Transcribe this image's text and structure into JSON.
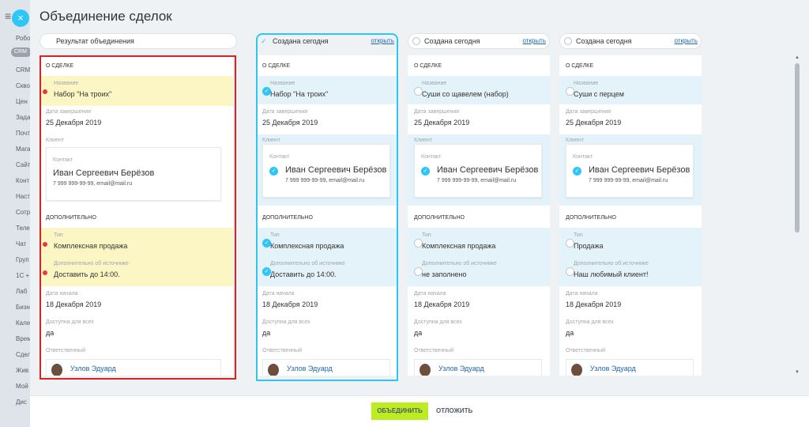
{
  "background_sidebar": {
    "menu_icon": "≡",
    "crm_badge": "CRM",
    "items": [
      "Робо",
      "CRM",
      "CRM",
      "Скво",
      "Цен",
      "Зада",
      "Почт",
      "Мага",
      "Сайт",
      "Конт",
      "Наст",
      "Сотр",
      "Теле",
      "Чат",
      "Груп",
      "1С +",
      "Лаб",
      "Бизн",
      "Кале",
      "Врем",
      "Сдел",
      "Жив",
      "Мой",
      "Дис"
    ]
  },
  "close_icon": "×",
  "title": "Объединение сделок",
  "result_header": "Результат объединения",
  "open_label": "открыть",
  "sections": {
    "about": "О СДЕЛКЕ",
    "extra": "ДОПОЛНИТЕЛЬНО"
  },
  "labels": {
    "name": "Название",
    "close_date": "Дата завершения",
    "client": "Клиент",
    "contact": "Контакт",
    "type": "Тип",
    "source_info": "Дополнительно об источнике",
    "start_date": "Дата начала",
    "public": "Доступна для всех",
    "responsible": "Ответственный"
  },
  "result": {
    "name": "Набор \"На троих\"",
    "close_date": "25 Декабря 2019",
    "contact_name": "Иван Сергеевич Берёзов",
    "contact_info": "7 999 999-99-99, email@mail.ru",
    "type": "Комплексная продажа",
    "source_info": "Доставить до 14:00.",
    "start_date": "18 Декабря 2019",
    "public": "да",
    "responsible": "Узлов Эдуард"
  },
  "deals": [
    {
      "header": "Создана сегодня",
      "name": "Набор \"На троих\"",
      "close_date": "25 Декабря 2019",
      "contact_name": "Иван Сергеевич Берёзов",
      "contact_info": "7 999 999-99-99, email@mail.ru",
      "type": "Комплексная продажа",
      "source_info": "Доставить до 14:00.",
      "start_date": "18 Декабря 2019",
      "public": "да",
      "responsible": "Узлов Эдуард"
    },
    {
      "header": "Создана сегодня",
      "name": "Суши со щавелем (набор)",
      "close_date": "25 Декабря 2019",
      "contact_name": "Иван Сергеевич Берёзов",
      "contact_info": "7 999 999-99-99, email@mail.ru",
      "type": "Комплексная продажа",
      "source_info": "не заполнено",
      "start_date": "18 Декабря 2019",
      "public": "да",
      "responsible": "Узлов Эдуард"
    },
    {
      "header": "Создана сегодня",
      "name": "Суши с перцем",
      "close_date": "25 Декабря 2019",
      "contact_name": "Иван Сергеевич Берёзов",
      "contact_info": "7 999 999-99-99, email@mail.ru",
      "type": "Продажа",
      "source_info": "Наш любимый клиент!",
      "start_date": "18 Декабря 2019",
      "public": "да",
      "responsible": "Узлов Эдуард"
    }
  ],
  "footer": {
    "merge": "объединить",
    "postpone": "отложить"
  },
  "colors": {
    "accent": "#2fc6f6",
    "merge_button": "#bbed21",
    "highlight_frame": "#e02020",
    "changed_field": "#fbf6c4"
  }
}
